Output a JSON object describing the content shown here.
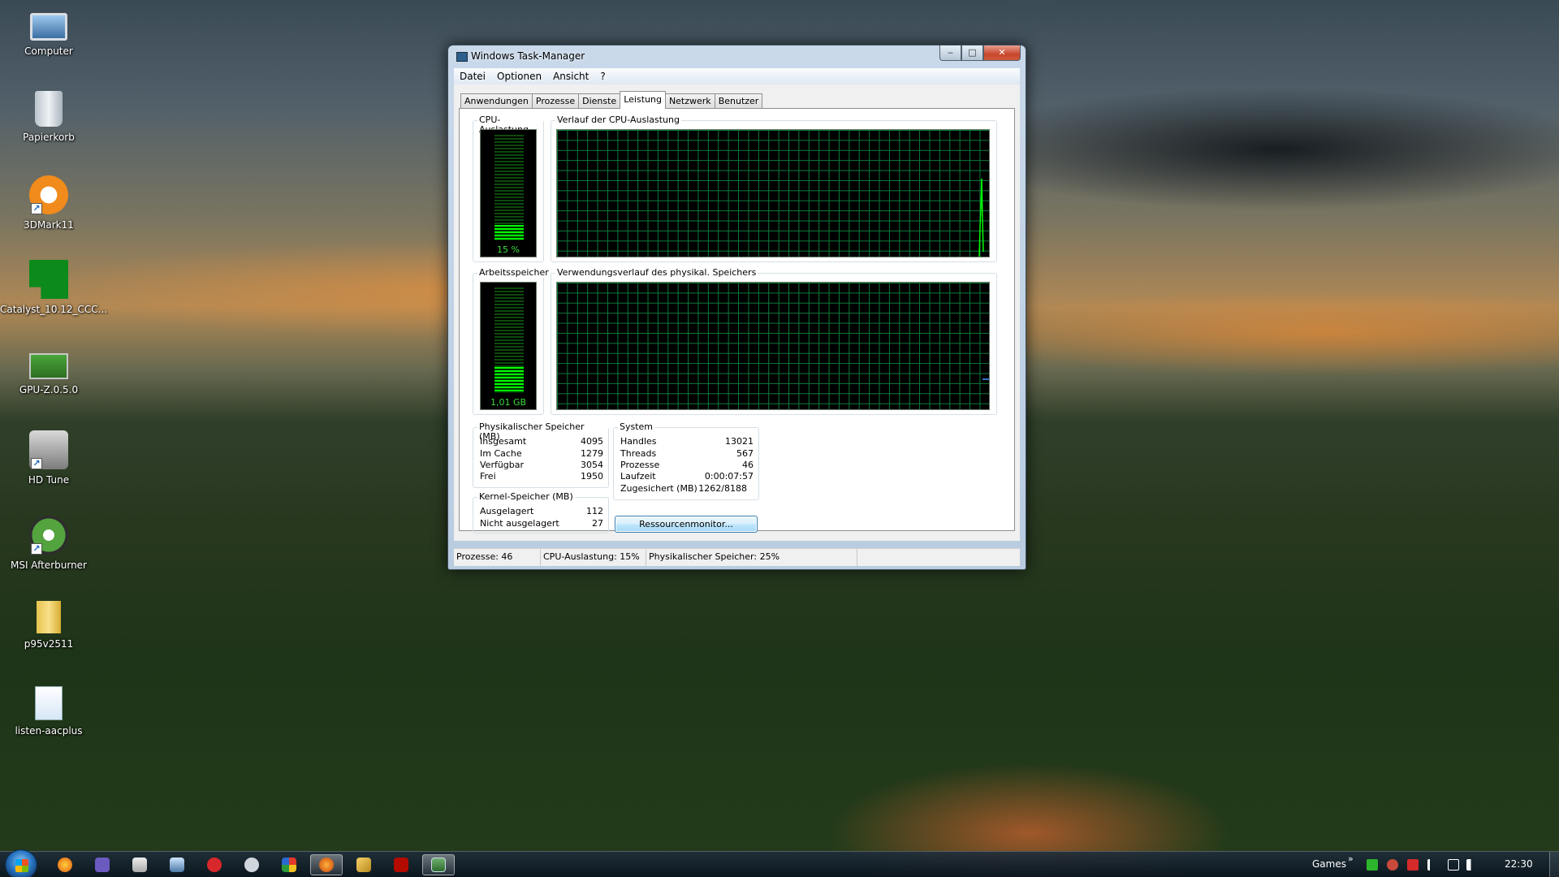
{
  "desktop": {
    "icons": [
      {
        "label": "Computer",
        "icon": "computer-icon"
      },
      {
        "label": "Papierkorb",
        "icon": "recycle-bin-icon"
      },
      {
        "label": "3DMark11",
        "icon": "3dmark-icon"
      },
      {
        "label": "Catalyst_10.12_CCC...",
        "icon": "catalyst-icon"
      },
      {
        "label": "GPU-Z.0.5.0",
        "icon": "gpuz-icon"
      },
      {
        "label": "HD Tune",
        "icon": "hdtune-icon"
      },
      {
        "label": "MSI Afterburner",
        "icon": "msi-afterburner-icon"
      },
      {
        "label": "p95v2511",
        "icon": "zip-folder-icon"
      },
      {
        "label": "listen-aacplus",
        "icon": "document-icon"
      }
    ]
  },
  "window": {
    "title": "Windows Task-Manager",
    "controls": {
      "minimize": "‒",
      "maximize": "□",
      "close": "✕"
    },
    "menu": [
      "Datei",
      "Optionen",
      "Ansicht",
      "?"
    ],
    "tabs": [
      "Anwendungen",
      "Prozesse",
      "Dienste",
      "Leistung",
      "Netzwerk",
      "Benutzer"
    ],
    "active_tab": "Leistung"
  },
  "performance": {
    "cpu_label": "CPU-Auslastung",
    "cpu_value": "15 %",
    "cpu_level": 0.15,
    "cpu_history_label": "Verlauf der CPU-Auslastung",
    "mem_label": "Arbeitsspeicher",
    "mem_value": "1,01 GB",
    "mem_level": 0.25,
    "mem_history_label": "Verwendungsverlauf des physikal. Speichers",
    "physical": {
      "title": "Physikalischer Speicher (MB)",
      "rows": [
        {
          "key": "Insgesamt",
          "value": "4095"
        },
        {
          "key": "Im Cache",
          "value": "1279"
        },
        {
          "key": "Verfügbar",
          "value": "3054"
        },
        {
          "key": "Frei",
          "value": "1950"
        }
      ]
    },
    "kernel": {
      "title": "Kernel-Speicher (MB)",
      "rows": [
        {
          "key": "Ausgelagert",
          "value": "112"
        },
        {
          "key": "Nicht ausgelagert",
          "value": "27"
        }
      ]
    },
    "system": {
      "title": "System",
      "rows": [
        {
          "key": "Handles",
          "value": "13021"
        },
        {
          "key": "Threads",
          "value": "567"
        },
        {
          "key": "Prozesse",
          "value": "46"
        },
        {
          "key": "Laufzeit",
          "value": "0:00:07:57"
        },
        {
          "key": "Zugesichert (MB)",
          "value": "1262/8188"
        }
      ]
    },
    "resource_button": "Ressourcenmonitor..."
  },
  "statusbar": {
    "processes": "Prozesse: 46",
    "cpu": "CPU-Auslastung: 15%",
    "memory": "Physikalischer Speicher: 25%"
  },
  "taskbar": {
    "pinned": [
      "firefox-icon",
      "z-icon",
      "calculator-icon",
      "monitor-icon",
      "burn-icon",
      "steam-icon",
      "shield-icon",
      "firefox-active-icon",
      "pen-icon",
      "adobe-icon",
      "task-manager-icon"
    ],
    "tray_label": "Games",
    "tray_chevron": "»",
    "clock": "22:30"
  },
  "colors": {
    "meter_green": "#00ff00",
    "grid_green": "#0c7a3a",
    "window_frame": "#c9d9ea"
  }
}
